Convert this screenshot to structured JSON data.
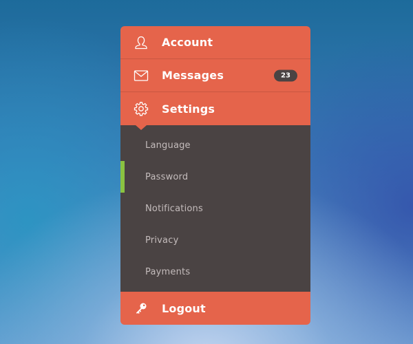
{
  "menu": {
    "account": {
      "label": "Account",
      "icon": "user-icon"
    },
    "messages": {
      "label": "Messages",
      "icon": "envelope-icon",
      "badge": "23"
    },
    "settings": {
      "label": "Settings",
      "icon": "gear-icon",
      "submenu": [
        {
          "label": "Language",
          "active": false
        },
        {
          "label": "Password",
          "active": true
        },
        {
          "label": "Notifications",
          "active": false
        },
        {
          "label": "Privacy",
          "active": false
        },
        {
          "label": "Payments",
          "active": false
        }
      ]
    },
    "logout": {
      "label": "Logout",
      "icon": "key-icon"
    }
  },
  "colors": {
    "menu_background": "#e5644b",
    "submenu_background": "#4a4343",
    "badge_background": "#4a4343",
    "active_indicator": "#8ac341",
    "submenu_text": "#c4bcbc"
  }
}
